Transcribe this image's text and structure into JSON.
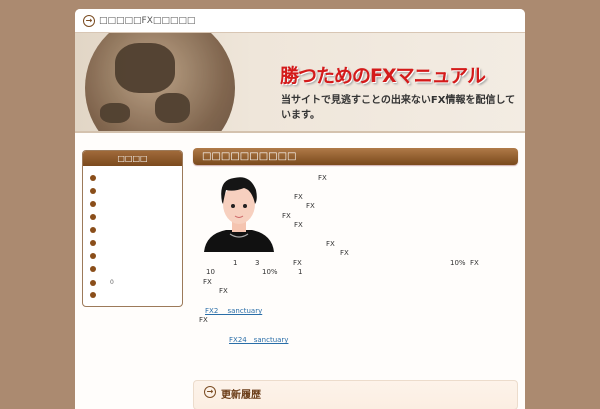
{
  "header": {
    "site_title": "□□□□□FX□□□□□",
    "banner_title": "勝つためのFXマニュアル",
    "banner_subtitle": "当サイトで見逃すことの出来ないFX情報を配信しています。"
  },
  "sidebar": {
    "title": "□□□□",
    "items": [
      "",
      "",
      "",
      "",
      "",
      "",
      "",
      "",
      "0",
      ""
    ]
  },
  "main": {
    "heading": "□□□□□□□□□□",
    "texts": [
      "FX",
      "FX",
      "FX",
      "FX",
      "FX",
      "FX",
      "FX",
      "1",
      "3",
      "FX",
      "10%",
      "FX",
      "10",
      "10%",
      "1",
      "FX",
      "FX",
      "FX"
    ],
    "links": [
      "FX2　 sanctuary",
      "FX24　sanctuary"
    ]
  },
  "history": {
    "title": "更新履歴"
  }
}
